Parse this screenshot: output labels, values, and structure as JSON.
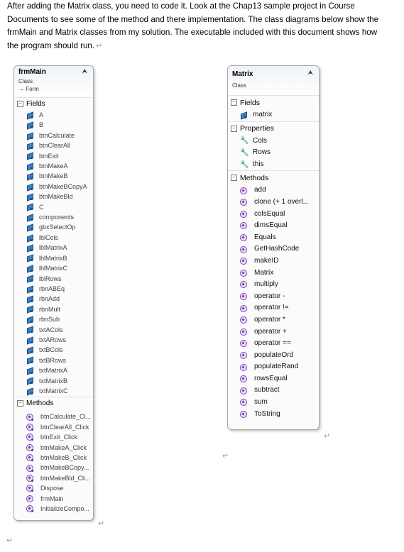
{
  "intro": {
    "lines": [
      "After adding the Matrix class, you need to code it.  Look at the Chap13 sample project in Course",
      "Documents to see some of the method and there implementation.  The class diagrams below show the",
      "frmMain and Matrix classes from my solution.  The executable included with this document shows how",
      "the program should run."
    ]
  },
  "frmMain": {
    "title": "frmMain",
    "kind": "Class",
    "base": "→ Form",
    "collapse_icon": "double-chevron-up",
    "fields_label": "Fields",
    "fields": [
      "A",
      "B",
      "btnCalculate",
      "btnClearAll",
      "btnExit",
      "btnMakeA",
      "btnMakeB",
      "btnMakeBCopyA",
      "btnMakeBld",
      "C",
      "components",
      "gbxSelectOp",
      "lblCols",
      "lblMatrixA",
      "lblMatrixB",
      "lblMatrixC",
      "lblRows",
      "rbnABEq",
      "rbnAdd",
      "rbnMult",
      "rbnSub",
      "txtACols",
      "txtARows",
      "txtBCols",
      "txtBRows",
      "txtMatrixA",
      "txtMatrixB",
      "txtMatrixC"
    ],
    "methods_label": "Methods",
    "methods": [
      "btnCalculate_Cl...",
      "btnClearAll_Click",
      "btnExit_Click",
      "btnMakeA_Click",
      "btnMakeB_Click",
      "btnMakeBCopy...",
      "btnMakeBld_Cli...",
      "Dispose",
      "frmMain",
      "InitializeCompo..."
    ]
  },
  "matrix": {
    "title": "Matrix",
    "kind": "Class",
    "collapse_icon": "double-chevron-up",
    "fields_label": "Fields",
    "fields": [
      "matrix"
    ],
    "properties_label": "Properties",
    "properties": [
      "Cols",
      "Rows",
      "this"
    ],
    "methods_label": "Methods",
    "methods": [
      "add",
      "clone (+ 1 overl...",
      "colsEqual",
      "dimsEqual",
      "Equals",
      "GetHashCode",
      "makeID",
      "Matrix",
      "multiply",
      "operator -",
      "operator !=",
      "operator *",
      "operator +",
      "operator ==",
      "populateOrd",
      "populateRand",
      "rowsEqual",
      "subtract",
      "sum",
      "ToString"
    ]
  },
  "colors": {
    "field_icon": "#3d7fc1",
    "method_icon": "#7a3fb5",
    "border": "#a6a6a6"
  }
}
